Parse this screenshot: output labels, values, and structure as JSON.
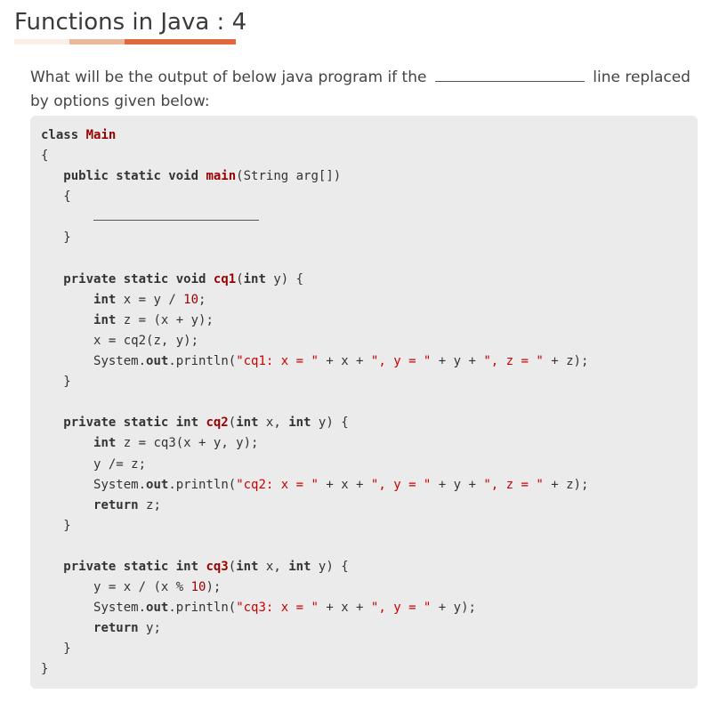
{
  "title": "Functions in Java : 4",
  "question": {
    "before_blank": "What will be the output of below java program if the",
    "after_blank": "line replaced by options given below:"
  },
  "code": {
    "l1_kw": "class",
    "l1_name": "Main",
    "l2": "{",
    "l3_kw": "public static void",
    "l3_fn": "main",
    "l3_rest": "(String arg[])",
    "l4": "{",
    "l6": "}",
    "l8_kw": "private static void",
    "l8_fn": "cq1",
    "l8_p1": "(",
    "l8_kw2": "int",
    "l8_rest": " y) {",
    "l9_kw": "int",
    "l9_a": " x = y / ",
    "l9_num": "10",
    "l9_b": ";",
    "l10_kw": "int",
    "l10_rest": " z = (x + y);",
    "l11": "x = cq2(z, y);",
    "l12_a": "System.",
    "l12_out": "out",
    "l12_b": ".println(",
    "l12_s1": "\"cq1: x = \"",
    "l12_c": " + x + ",
    "l12_s2": "\", y = \"",
    "l12_d": " + y + ",
    "l12_s3": "\", z = \"",
    "l12_e": " + z);",
    "l13": "}",
    "l15_kw": "private static int",
    "l15_fn": "cq2",
    "l15_p1": "(",
    "l15_kw2": "int",
    "l15_mid": " x, ",
    "l15_kw3": "int",
    "l15_rest": " y) {",
    "l16_kw": "int",
    "l16_rest": " z = cq3(x + y, y);",
    "l17": "y /= z;",
    "l18_a": "System.",
    "l18_out": "out",
    "l18_b": ".println(",
    "l18_s1": "\"cq2: x = \"",
    "l18_c": " + x + ",
    "l18_s2": "\", y = \"",
    "l18_d": " + y + ",
    "l18_s3": "\", z = \"",
    "l18_e": " + z);",
    "l19_kw": "return",
    "l19_rest": " z;",
    "l20": "}",
    "l22_kw": "private static int",
    "l22_fn": "cq3",
    "l22_p1": "(",
    "l22_kw2": "int",
    "l22_mid": " x, ",
    "l22_kw3": "int",
    "l22_rest": " y) {",
    "l23_a": "y = x / (x % ",
    "l23_num": "10",
    "l23_b": ");",
    "l24_a": "System.",
    "l24_out": "out",
    "l24_b": ".println(",
    "l24_s1": "\"cq3: x = \"",
    "l24_c": " + x + ",
    "l24_s2": "\", y = \"",
    "l24_d": " + y);",
    "l25_kw": "return",
    "l25_rest": " y;",
    "l26": "}",
    "l27": "}"
  }
}
